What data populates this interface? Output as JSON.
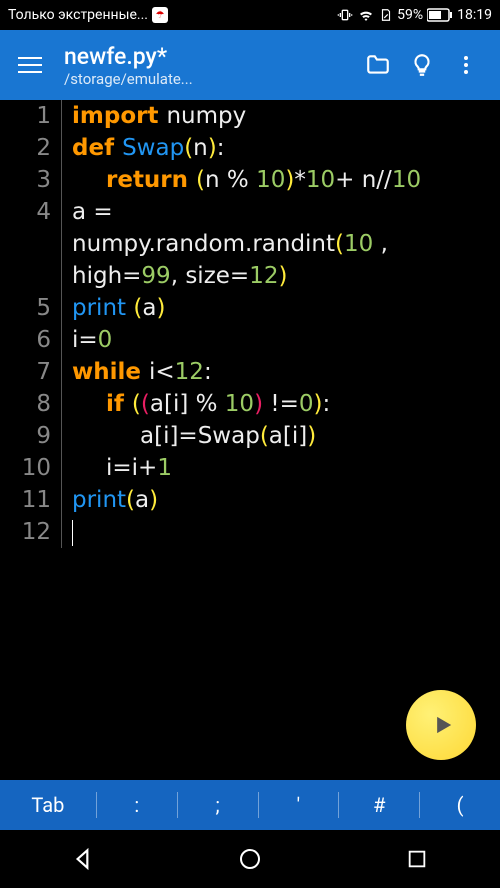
{
  "status": {
    "network": "Только экстренные...",
    "battery_pct": "59%",
    "time": "18:19"
  },
  "appbar": {
    "filename": "newfe.py*",
    "filepath": "/storage/emulate..."
  },
  "code": {
    "lines": [
      {
        "n": "1",
        "tokens": [
          {
            "t": "import ",
            "c": "kw"
          },
          {
            "t": "numpy",
            "c": ""
          }
        ]
      },
      {
        "n": "2",
        "tokens": [
          {
            "t": "def ",
            "c": "kw"
          },
          {
            "t": "Swap",
            "c": "blue"
          },
          {
            "t": "(",
            "c": "paren-y"
          },
          {
            "t": "n",
            "c": ""
          },
          {
            "t": ")",
            "c": "paren-y"
          },
          {
            "t": ":",
            "c": ""
          }
        ]
      },
      {
        "n": "3",
        "indent": 1,
        "tokens": [
          {
            "t": "return ",
            "c": "kw"
          },
          {
            "t": "(",
            "c": "paren-y"
          },
          {
            "t": "n % ",
            "c": ""
          },
          {
            "t": "10",
            "c": "num"
          },
          {
            "t": ")",
            "c": "paren-y"
          },
          {
            "t": "*",
            "c": ""
          },
          {
            "t": "10",
            "c": "num"
          },
          {
            "t": "+ n//",
            "c": ""
          },
          {
            "t": "10",
            "c": "num"
          }
        ]
      },
      {
        "n": "4",
        "tokens": [
          {
            "t": "a = ",
            "c": ""
          }
        ]
      },
      {
        "n": "",
        "cont": true,
        "tokens": [
          {
            "t": "numpy.random.randint",
            "c": ""
          },
          {
            "t": "(",
            "c": "paren-y"
          },
          {
            "t": "10",
            "c": "num"
          },
          {
            "t": " , ",
            "c": ""
          }
        ]
      },
      {
        "n": "",
        "cont": true,
        "tokens": [
          {
            "t": "high=",
            "c": ""
          },
          {
            "t": "99",
            "c": "num"
          },
          {
            "t": ", size=",
            "c": ""
          },
          {
            "t": "12",
            "c": "num"
          },
          {
            "t": ")",
            "c": "paren-y"
          }
        ]
      },
      {
        "n": "5",
        "tokens": [
          {
            "t": "print ",
            "c": "blue"
          },
          {
            "t": "(",
            "c": "paren-y"
          },
          {
            "t": "a",
            "c": ""
          },
          {
            "t": ")",
            "c": "paren-y"
          }
        ]
      },
      {
        "n": "6",
        "tokens": [
          {
            "t": "i=",
            "c": ""
          },
          {
            "t": "0",
            "c": "num"
          }
        ]
      },
      {
        "n": "7",
        "tokens": [
          {
            "t": "while ",
            "c": "kw"
          },
          {
            "t": "i<",
            "c": ""
          },
          {
            "t": "12",
            "c": "num"
          },
          {
            "t": ":",
            "c": ""
          }
        ]
      },
      {
        "n": "8",
        "indent": 1,
        "tokens": [
          {
            "t": "if ",
            "c": "kw"
          },
          {
            "t": "(",
            "c": "paren-y"
          },
          {
            "t": "(",
            "c": "paren-m"
          },
          {
            "t": "a[i] % ",
            "c": ""
          },
          {
            "t": "10",
            "c": "num"
          },
          {
            "t": ")",
            "c": "paren-m"
          },
          {
            "t": " !=",
            "c": ""
          },
          {
            "t": "0",
            "c": "num"
          },
          {
            "t": ")",
            "c": "paren-y"
          },
          {
            "t": ":",
            "c": ""
          }
        ]
      },
      {
        "n": "9",
        "indent": 2,
        "tokens": [
          {
            "t": "a[i]=Swap",
            "c": ""
          },
          {
            "t": "(",
            "c": "paren-y"
          },
          {
            "t": "a[i]",
            "c": ""
          },
          {
            "t": ")",
            "c": "paren-y"
          }
        ]
      },
      {
        "n": "10",
        "indent": 1,
        "tokens": [
          {
            "t": "i=i+",
            "c": ""
          },
          {
            "t": "1",
            "c": "num"
          }
        ]
      },
      {
        "n": "11",
        "tokens": [
          {
            "t": "print",
            "c": "blue"
          },
          {
            "t": "(",
            "c": "paren-y"
          },
          {
            "t": "a",
            "c": ""
          },
          {
            "t": ")",
            "c": "paren-y"
          }
        ]
      },
      {
        "n": "12",
        "tokens": [],
        "cursor": true
      }
    ]
  },
  "keyrow": {
    "keys": [
      "Tab",
      ":",
      ";",
      "'",
      "#",
      "("
    ]
  }
}
